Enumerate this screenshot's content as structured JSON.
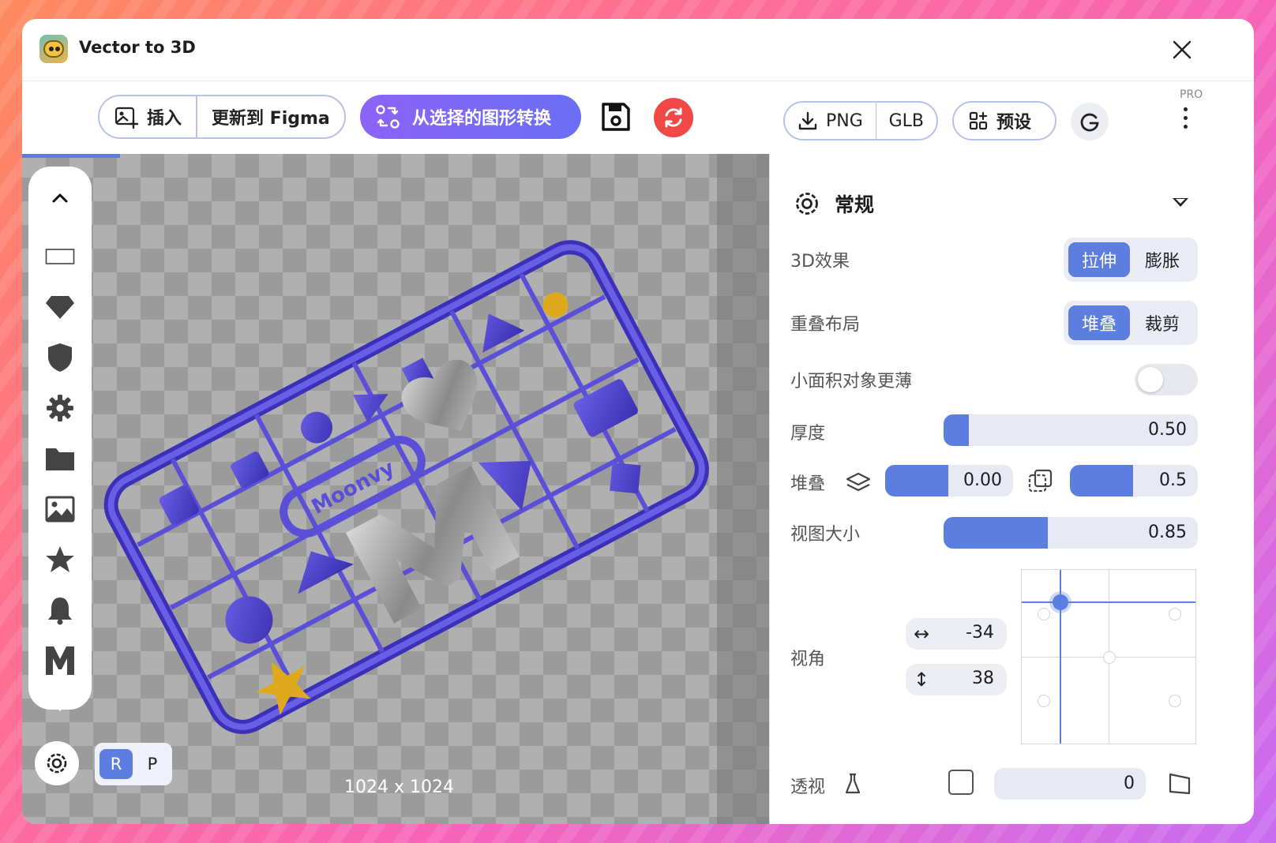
{
  "window": {
    "title": "Vector to 3D"
  },
  "toolbar": {
    "insert_label": "插入",
    "update_label": "更新到 Figma",
    "convert_label": "从选择的图形转换",
    "png_label": "PNG",
    "glb_label": "GLB",
    "presets_label": "预设",
    "pro_label": "PRO"
  },
  "canvas": {
    "dimensions": "1024 x 1024",
    "render_modes": [
      "R",
      "P"
    ],
    "active_render_mode": "R",
    "load_progress": 0.13,
    "sidebar_tools": [
      "chevron-up",
      "rectangle",
      "gem",
      "shield",
      "gear",
      "folder",
      "image",
      "star",
      "bell",
      "m-letter"
    ]
  },
  "panel": {
    "section_title": "常规",
    "rows": {
      "effect": {
        "label": "3D效果",
        "options": [
          "拉伸",
          "膨胀"
        ],
        "selected": 0
      },
      "overlap": {
        "label": "重叠布局",
        "options": [
          "堆叠",
          "裁剪"
        ],
        "selected": 0
      },
      "thinner": {
        "label": "小面积对象更薄",
        "enabled": false
      },
      "thickness": {
        "label": "厚度",
        "value": "0.50",
        "fraction": 0.5
      },
      "stack": {
        "label": "堆叠",
        "value1": "0.00",
        "fraction1": 0.0,
        "value2": "0.5",
        "fraction2": 0.5
      },
      "view_size": {
        "label": "视图大小",
        "value": "0.85",
        "fraction": 0.85
      },
      "view_angle": {
        "label": "视角",
        "horizontal": "-34",
        "vertical": "38"
      },
      "perspective": {
        "label": "透视",
        "value": "0",
        "enabled": false
      }
    }
  },
  "colors": {
    "accent": "#5b7ee0",
    "convert_start": "#8c63f6",
    "convert_end": "#6a6ff4",
    "refresh": "#f04747"
  }
}
